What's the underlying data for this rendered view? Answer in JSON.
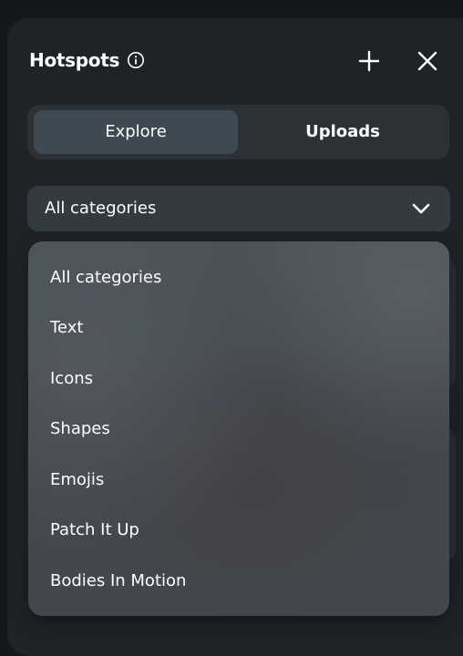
{
  "header": {
    "title": "Hotspots",
    "icons": [
      "info-icon",
      "add-icon",
      "close-icon"
    ]
  },
  "tabs": [
    {
      "label": "Explore",
      "selected": true
    },
    {
      "label": "Uploads",
      "selected": false
    }
  ],
  "category_select": {
    "value": "All categories",
    "icon": "chevron-down-icon"
  },
  "dropdown": {
    "options": [
      "All categories",
      "Text",
      "Icons",
      "Shapes",
      "Emojis",
      "Patch It Up",
      "Bodies In Motion"
    ]
  },
  "colors": {
    "page_background": "#15181b",
    "panel_background": "#1f2327",
    "tab_group_background": "#2c3136",
    "selected_tab_background": "#3f4951",
    "select_background": "#333a41",
    "text": "#ffffff"
  }
}
